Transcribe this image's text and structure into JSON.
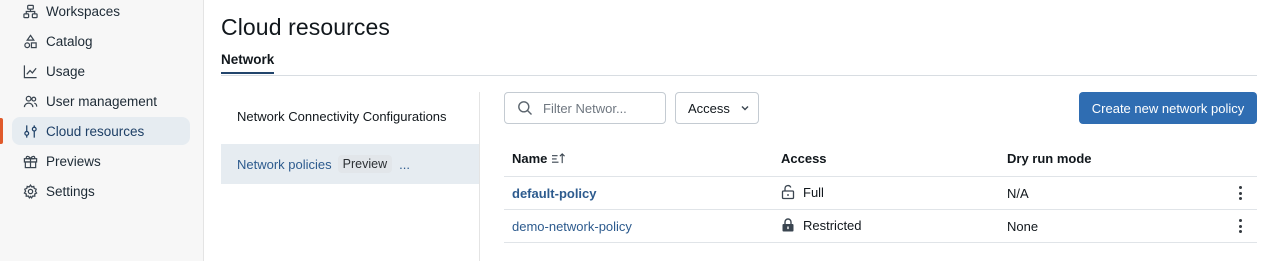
{
  "sidebar": {
    "items": [
      {
        "label": "Workspaces",
        "icon": "workspaces-icon"
      },
      {
        "label": "Catalog",
        "icon": "catalog-icon"
      },
      {
        "label": "Usage",
        "icon": "usage-chart-icon"
      },
      {
        "label": "User management",
        "icon": "users-icon"
      },
      {
        "label": "Cloud resources",
        "icon": "sliders-icon",
        "active": true
      },
      {
        "label": "Previews",
        "icon": "gift-icon"
      },
      {
        "label": "Settings",
        "icon": "gear-icon"
      }
    ],
    "accent_color": "#e05a2b"
  },
  "page": {
    "title": "Cloud resources",
    "tabs": [
      {
        "label": "Network",
        "active": true
      }
    ]
  },
  "subnav": {
    "items": [
      {
        "label": "Network Connectivity Configurations"
      },
      {
        "label": "Network policies",
        "badge": "Preview",
        "more": "...",
        "active": true
      }
    ]
  },
  "toolbar": {
    "search_placeholder": "Filter Networ...",
    "access_label": "Access",
    "create_label": "Create new network policy",
    "primary_color": "#2f6db2"
  },
  "table": {
    "headers": [
      "Name",
      "Access",
      "Dry run mode"
    ],
    "sort": "ascending",
    "rows": [
      {
        "name": "default-policy",
        "access": "Full",
        "access_icon": "unlock-icon",
        "dry_run": "N/A"
      },
      {
        "name": "demo-network-policy",
        "access": "Restricted",
        "access_icon": "lock-icon",
        "dry_run": "None"
      }
    ]
  }
}
